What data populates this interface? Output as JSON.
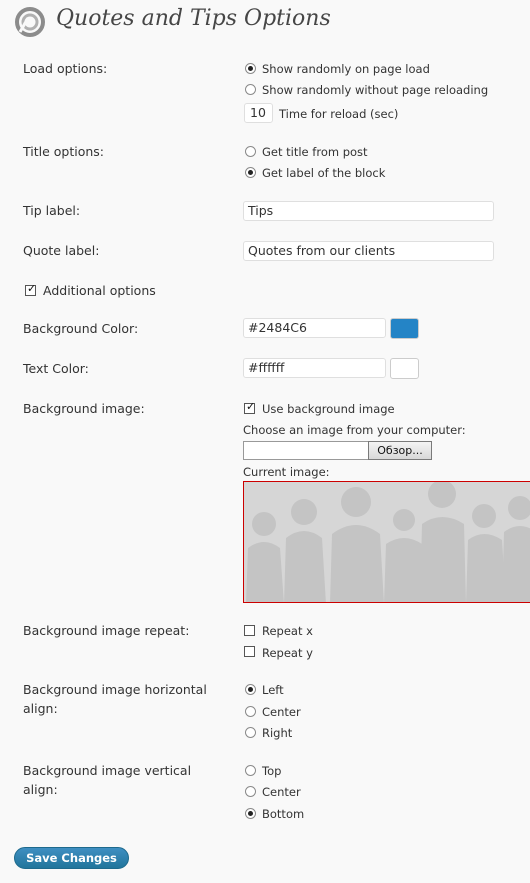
{
  "page": {
    "title": "Quotes and Tips Options"
  },
  "load_options": {
    "label": "Load options:",
    "options": [
      "Show randomly on page load",
      "Show randomly without page reloading"
    ],
    "selected": "Show randomly on page load",
    "reload_time_value": "10",
    "reload_time_label": "Time for reload (sec)"
  },
  "title_options": {
    "label": "Title options:",
    "options": [
      "Get title from post",
      "Get label of the block"
    ],
    "selected": "Get label of the block"
  },
  "tip_label": {
    "label": "Tip label:",
    "value": "Tips"
  },
  "quote_label": {
    "label": "Quote label:",
    "value": "Quotes from our clients"
  },
  "additional_options": {
    "label": "Additional options",
    "checked": true
  },
  "background_color": {
    "label": "Background Color:",
    "value": "#2484C6",
    "swatch": "#2484c6"
  },
  "text_color": {
    "label": "Text Color:",
    "value": "#ffffff",
    "swatch": "#ffffff"
  },
  "background_image": {
    "label": "Background image:",
    "use_label": "Use background image",
    "use_checked": true,
    "choose_label": "Choose an image from your computer:",
    "browse_label": "Обзор...",
    "current_label": "Current image:"
  },
  "image_repeat": {
    "label": "Background image repeat:",
    "options": [
      "Repeat x",
      "Repeat y"
    ],
    "checked": [
      false,
      false
    ]
  },
  "horizontal_align": {
    "label_line1": "Background image horizontal",
    "label_line2": "align:",
    "options": [
      "Left",
      "Center",
      "Right"
    ],
    "selected": "Left"
  },
  "vertical_align": {
    "label_line1": "Background image vertical",
    "label_line2": "align:",
    "options": [
      "Top",
      "Center",
      "Bottom"
    ],
    "selected": "Bottom"
  },
  "save_button": {
    "label": "Save Changes"
  }
}
